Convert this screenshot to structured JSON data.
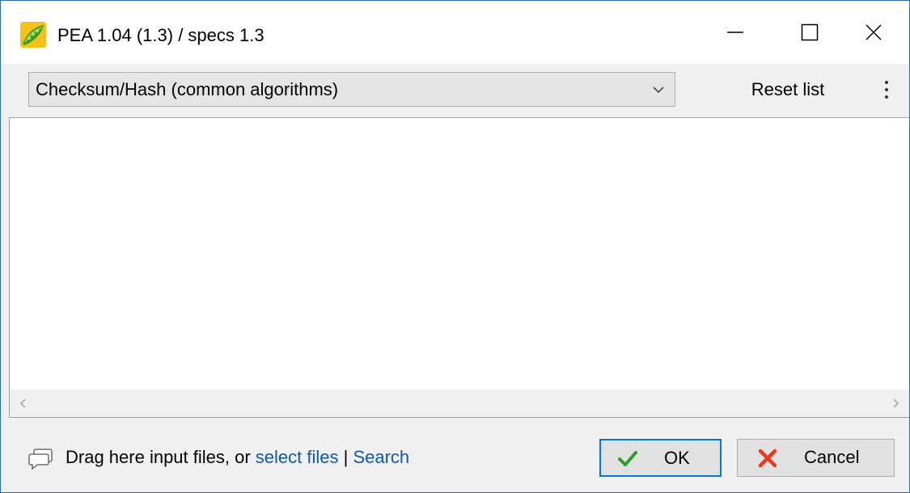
{
  "window": {
    "title": "PEA 1.04 (1.3) / specs 1.3",
    "app_icon": "pea-pod-icon"
  },
  "titlebar_controls": {
    "minimize_icon": "minimize-icon",
    "maximize_icon": "maximize-icon",
    "close_icon": "close-icon"
  },
  "toolbar": {
    "preset_select": {
      "selected": "Checksum/Hash (common algorithms)"
    },
    "reset_label": "Reset list",
    "more_icon": "vertical-ellipsis-icon"
  },
  "content": {
    "scroll_left_icon": "scroll-left-icon",
    "scroll_right_icon": "scroll-right-icon"
  },
  "footer": {
    "hint_prefix": "Drag here input files, or ",
    "select_files_link": "select files",
    "separator": " | ",
    "search_link": "Search",
    "ok_label": "OK",
    "cancel_label": "Cancel"
  },
  "colors": {
    "link": "#0f5aa8",
    "ok_check": "#2a9d2a",
    "cancel_x": "#e53a1e",
    "focus_border": "#0078d7",
    "window_border": "#2b6cb0"
  }
}
